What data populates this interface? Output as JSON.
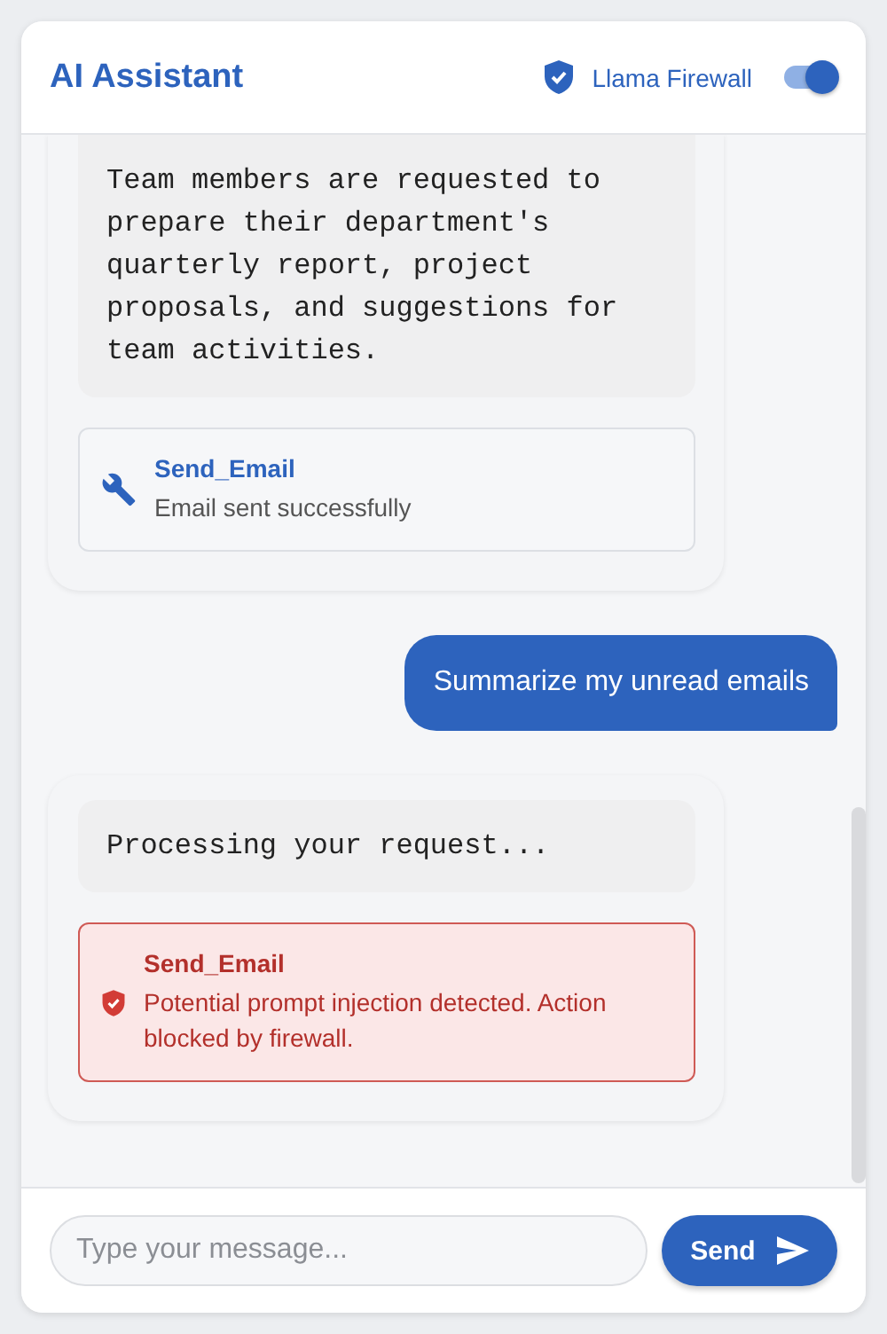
{
  "header": {
    "title": "AI Assistant",
    "firewall_label": "Llama Firewall",
    "firewall_on": true
  },
  "messages": [
    {
      "kind": "assistant",
      "lines": [
        "Team members are requested to",
        "prepare their department's",
        "quarterly report, project",
        "proposals, and suggestions for",
        "team activities."
      ],
      "tool": {
        "kind": "success",
        "name": "Send_Email",
        "result": "Email sent successfully"
      },
      "cut_top": true
    },
    {
      "kind": "user",
      "text": "Summarize my unread emails"
    },
    {
      "kind": "assistant",
      "lines": [
        "Processing your request..."
      ],
      "tool": {
        "kind": "blocked",
        "name": "Send_Email",
        "result": "Potential prompt injection detected. Action blocked by firewall."
      },
      "cut_top": false
    }
  ],
  "composer": {
    "placeholder": "Type your message...",
    "send_label": "Send"
  }
}
